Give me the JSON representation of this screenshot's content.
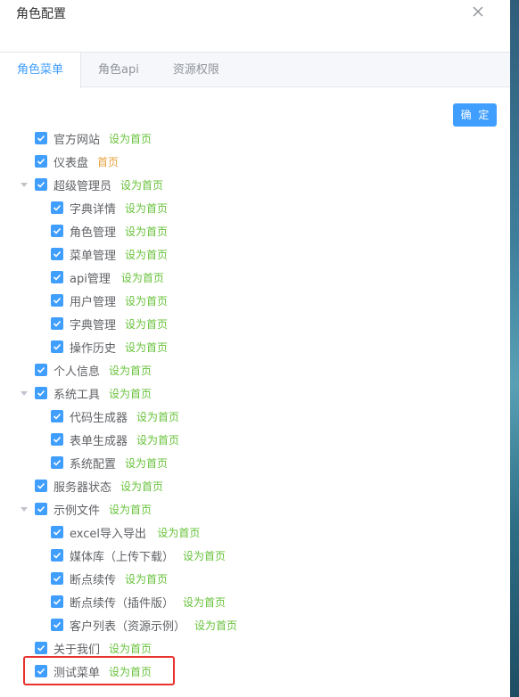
{
  "dialog": {
    "title": "角色配置"
  },
  "tabs": [
    {
      "label": "角色菜单",
      "active": true
    },
    {
      "label": "角色api",
      "active": false
    },
    {
      "label": "资源权限",
      "active": false
    }
  ],
  "confirm_label": "确 定",
  "colors": {
    "accent": "#409eff",
    "set_home": "#67c23a",
    "is_home": "#e6a23c",
    "highlight": "#e8322e"
  },
  "tree": [
    {
      "label": "官方网站",
      "link": "设为首页",
      "level": 0,
      "expandable": false,
      "checked": true
    },
    {
      "label": "仪表盘",
      "link": "首页",
      "level": 0,
      "expandable": false,
      "checked": true,
      "is_home": true
    },
    {
      "label": "超级管理员",
      "link": "设为首页",
      "level": 0,
      "expandable": true,
      "checked": true
    },
    {
      "label": "字典详情",
      "link": "设为首页",
      "level": 1,
      "expandable": false,
      "checked": true
    },
    {
      "label": "角色管理",
      "link": "设为首页",
      "level": 1,
      "expandable": false,
      "checked": true
    },
    {
      "label": "菜单管理",
      "link": "设为首页",
      "level": 1,
      "expandable": false,
      "checked": true
    },
    {
      "label": "api管理",
      "link": "设为首页",
      "level": 1,
      "expandable": false,
      "checked": true
    },
    {
      "label": "用户管理",
      "link": "设为首页",
      "level": 1,
      "expandable": false,
      "checked": true
    },
    {
      "label": "字典管理",
      "link": "设为首页",
      "level": 1,
      "expandable": false,
      "checked": true
    },
    {
      "label": "操作历史",
      "link": "设为首页",
      "level": 1,
      "expandable": false,
      "checked": true
    },
    {
      "label": "个人信息",
      "link": "设为首页",
      "level": 0,
      "expandable": false,
      "checked": true
    },
    {
      "label": "系统工具",
      "link": "设为首页",
      "level": 0,
      "expandable": true,
      "checked": true
    },
    {
      "label": "代码生成器",
      "link": "设为首页",
      "level": 1,
      "expandable": false,
      "checked": true
    },
    {
      "label": "表单生成器",
      "link": "设为首页",
      "level": 1,
      "expandable": false,
      "checked": true
    },
    {
      "label": "系统配置",
      "link": "设为首页",
      "level": 1,
      "expandable": false,
      "checked": true
    },
    {
      "label": "服务器状态",
      "link": "设为首页",
      "level": 0,
      "expandable": false,
      "checked": true
    },
    {
      "label": "示例文件",
      "link": "设为首页",
      "level": 0,
      "expandable": true,
      "checked": true
    },
    {
      "label": "excel导入导出",
      "link": "设为首页",
      "level": 1,
      "expandable": false,
      "checked": true
    },
    {
      "label": "媒体库（上传下载）",
      "link": "设为首页",
      "level": 1,
      "expandable": false,
      "checked": true
    },
    {
      "label": "断点续传",
      "link": "设为首页",
      "level": 1,
      "expandable": false,
      "checked": true
    },
    {
      "label": "断点续传（插件版）",
      "link": "设为首页",
      "level": 1,
      "expandable": false,
      "checked": true
    },
    {
      "label": "客户列表（资源示例）",
      "link": "设为首页",
      "level": 1,
      "expandable": false,
      "checked": true
    },
    {
      "label": "关于我们",
      "link": "设为首页",
      "level": 0,
      "expandable": false,
      "checked": true
    },
    {
      "label": "测试菜单",
      "link": "设为首页",
      "level": 0,
      "expandable": false,
      "checked": true
    }
  ]
}
